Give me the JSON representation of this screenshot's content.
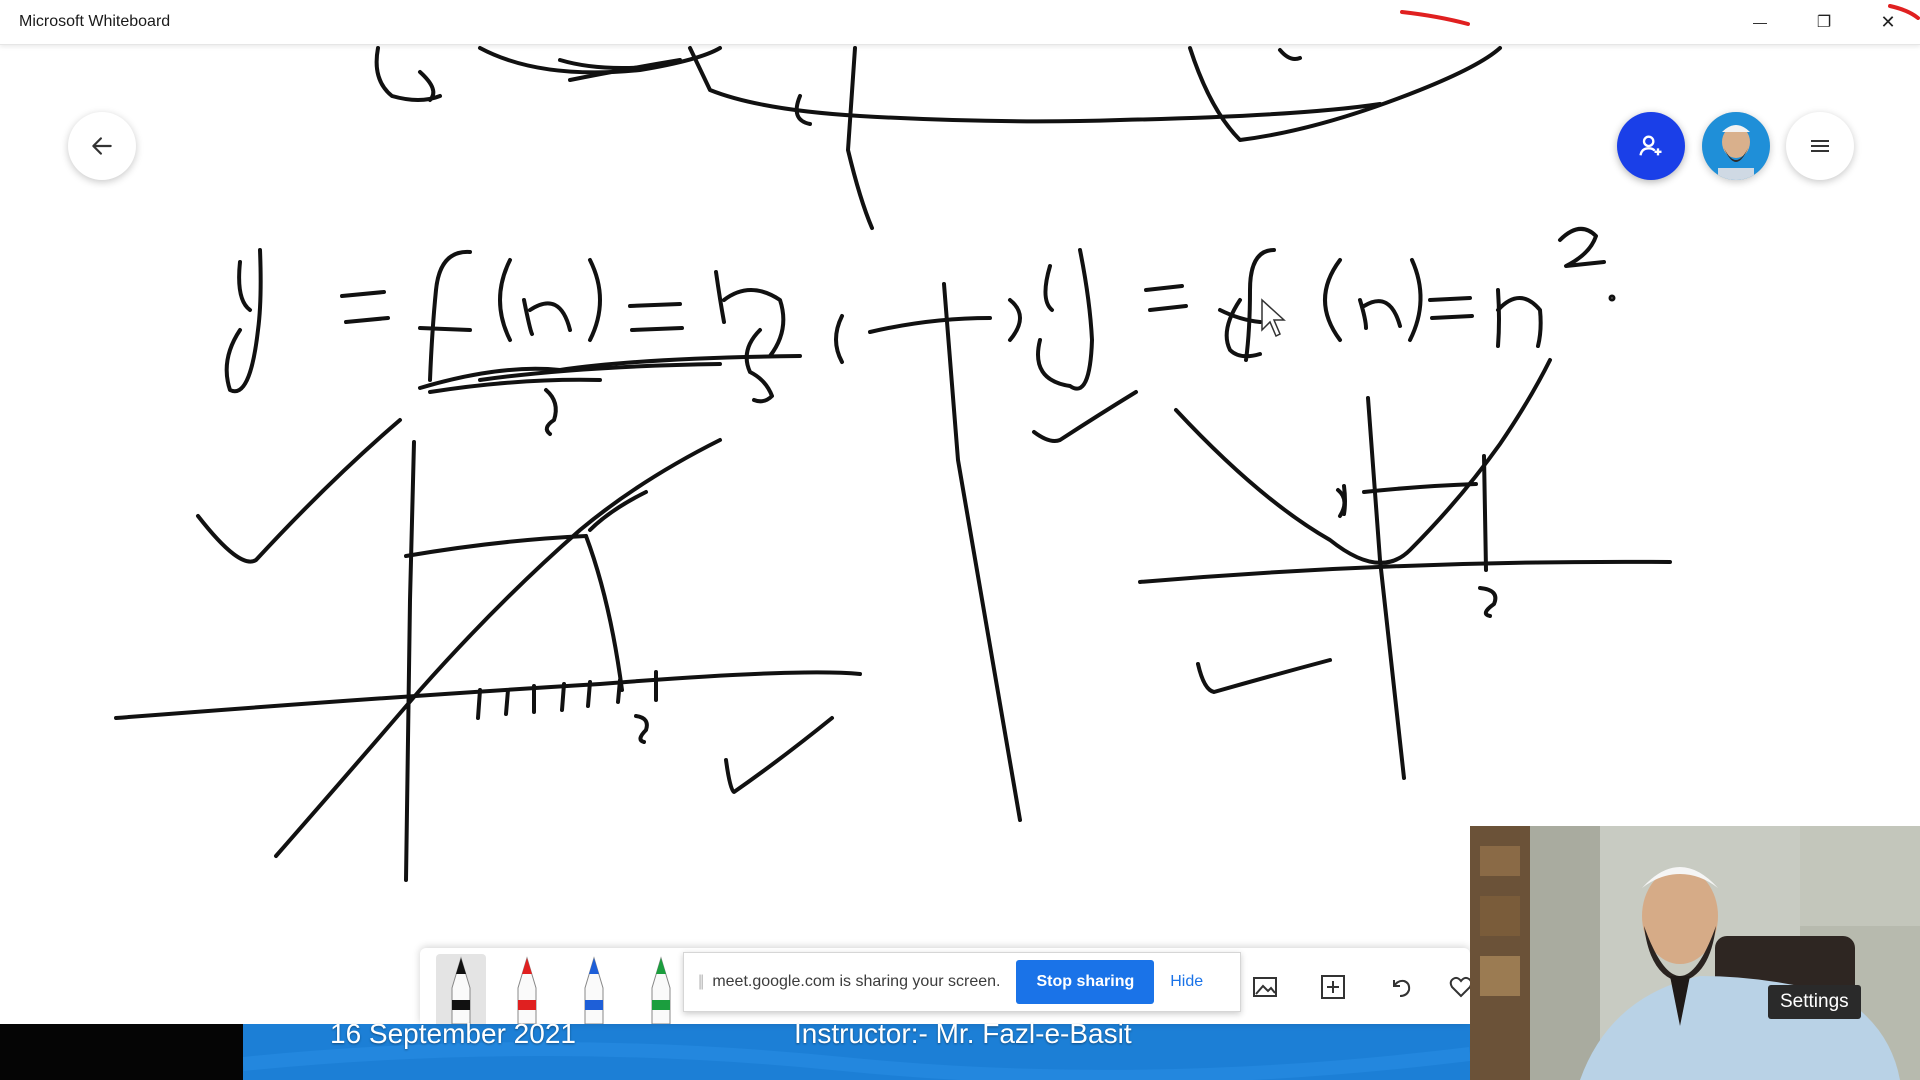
{
  "window": {
    "title": "Microsoft Whiteboard",
    "minimize_glyph": "—",
    "restore_glyph": "❐",
    "close_glyph": "✕"
  },
  "canvas": {
    "ink_color": "#111111"
  },
  "header_buttons": {
    "back_icon": "arrow-left-icon",
    "invite_icon": "add-person-icon",
    "invite_color": "#1a3fe8",
    "menu_icon": "hamburger-menu-icon"
  },
  "toolbar": {
    "pens": [
      {
        "name": "black-pen",
        "color": "#111111"
      },
      {
        "name": "red-pen",
        "color": "#e02020"
      },
      {
        "name": "blue-pen",
        "color": "#1e5fd8"
      },
      {
        "name": "green-pen",
        "color": "#1b9e3e"
      }
    ],
    "tools": [
      "image-icon",
      "add-icon",
      "undo-icon",
      "heart-icon"
    ]
  },
  "share_banner": {
    "grip": "||",
    "text": "meet.google.com is sharing your screen.",
    "stop_label": "Stop sharing",
    "hide_label": "Hide"
  },
  "footer": {
    "date": "16 September 2021",
    "instructor": "Instructor:- Mr. Fazl-e-Basit",
    "bar_color": "#1c7fd6"
  },
  "webcam": {
    "settings_label": "Settings"
  }
}
